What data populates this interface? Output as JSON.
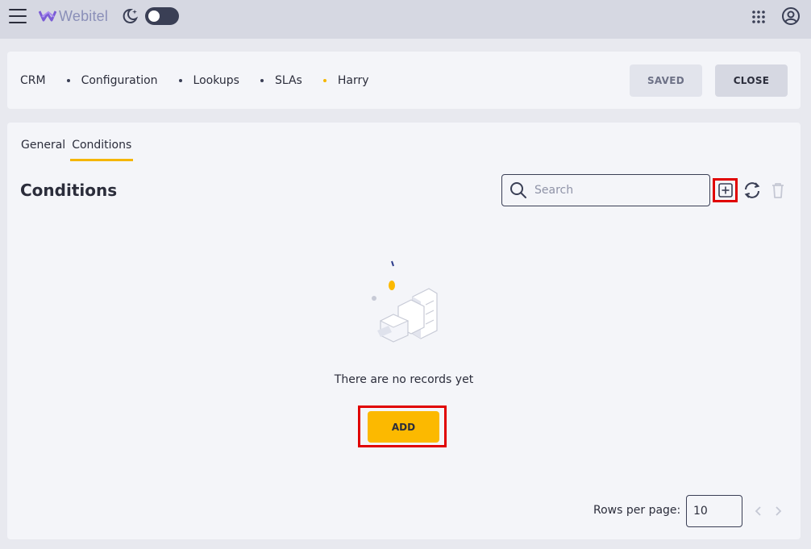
{
  "topbar": {
    "menu_icon": "hamburger-icon",
    "logo_text": "Webitel",
    "theme_icon": "moon-stars-icon",
    "apps_icon": "apps-grid-icon",
    "account_icon": "account-icon"
  },
  "breadcrumb": [
    "CRM",
    "Configuration",
    "Lookups",
    "SLAs",
    "Harry"
  ],
  "header": {
    "saved_label": "SAVED",
    "close_label": "CLOSE"
  },
  "tabs": [
    "General",
    "Conditions"
  ],
  "active_tab": "Conditions",
  "section": {
    "title": "Conditions",
    "search_placeholder": "Search"
  },
  "empty_state": {
    "text": "There are no records yet",
    "add_label": "ADD"
  },
  "pagination": {
    "rows_label": "Rows per page:",
    "rows_value": "10"
  },
  "colors": {
    "accent": "#fcb900",
    "highlight": "#e00000",
    "text": "#2b2d3b",
    "logo": "#8a8fb8"
  }
}
